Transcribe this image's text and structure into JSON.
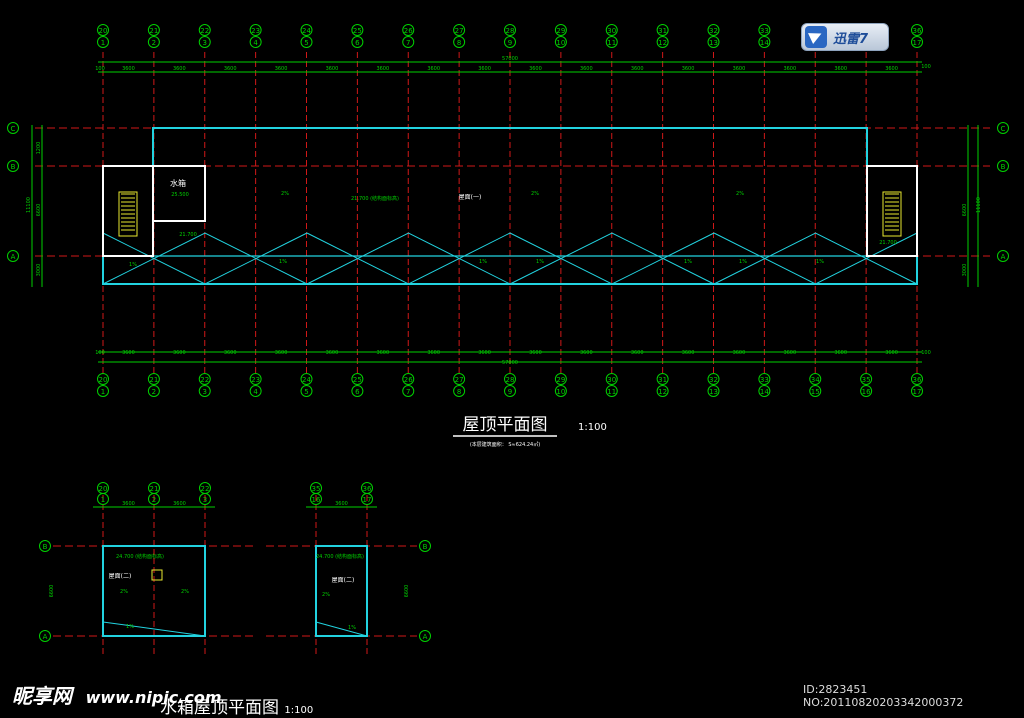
{
  "drawing": {
    "main_title": "屋顶平面图",
    "main_scale": "1:100",
    "main_note": "(本层建筑面积：  S≈624.24㎡)",
    "sub_title": "水箱屋顶平面图",
    "sub_scale": "1:100",
    "total_dim": "57000",
    "top_axes_outer": [
      "20",
      "21",
      "22",
      "23",
      "24",
      "25",
      "26",
      "27",
      "28",
      "29",
      "30",
      "31",
      "32",
      "33",
      "34",
      "35",
      "36"
    ],
    "top_axes_inner": [
      "1",
      "2",
      "3",
      "4",
      "5",
      "6",
      "7",
      "8",
      "9",
      "10",
      "11",
      "12",
      "13",
      "14",
      "15",
      "16",
      "17"
    ],
    "bay_dims": [
      "3600",
      "3600",
      "3600",
      "3600",
      "3600",
      "3600",
      "3600",
      "3600",
      "3600",
      "3600",
      "3600",
      "3600",
      "3600",
      "3600",
      "3600",
      "3600"
    ],
    "end_dim": "100",
    "row_axes": [
      "C",
      "B",
      "A"
    ],
    "left_dims": [
      "1200",
      "6600",
      "3000"
    ],
    "left_total": "11100",
    "water_tank_label": "水箱",
    "water_tank_level": "25.500",
    "level_main": "21.700",
    "level_note": "(结构面标高)",
    "roof_one": "屋面(一)",
    "roof_two": "屋面(二)",
    "level_tank_roof": "24.700",
    "slope_2": "2%",
    "slope_1": "1%",
    "sub_left_axes_outer": [
      "20",
      "21",
      "22"
    ],
    "sub_left_axes_inner": [
      "1",
      "2",
      "3"
    ],
    "sub_right_axes_outer": [
      "35",
      "36"
    ],
    "sub_right_axes_inner": [
      "16",
      "17"
    ],
    "sub_dim": "3600",
    "sub_height": "6600"
  },
  "badge": {
    "label": "迅雷7"
  },
  "watermark": {
    "site": "昵享网",
    "url": "www.nipic.com"
  },
  "image_id": "ID:2823451 NO:20110820203342000372",
  "colors": {
    "green": "#00d000",
    "cyan": "#22d3e0",
    "red": "#d01818",
    "white": "#ffffff",
    "yellow": "#e8e830"
  }
}
